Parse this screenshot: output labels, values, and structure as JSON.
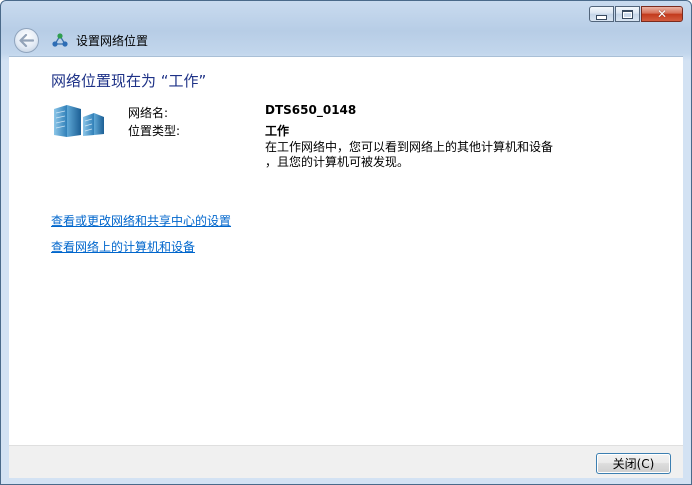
{
  "window": {
    "title": "设置网络位置",
    "close_symbol": "✕"
  },
  "main": {
    "heading": "网络位置现在为 “工作”",
    "network_name_label": "网络名:",
    "network_name_value": "DTS650_0148",
    "location_type_label": "位置类型:",
    "location_type_value": "工作",
    "description_line1": "在工作网络中，您可以看到网络上的其他计算机和设备",
    "description_line2": "，且您的计算机可被发现。",
    "links": [
      "查看或更改网络和共享中心的设置",
      "查看网络上的计算机和设备"
    ]
  },
  "footer": {
    "close_button_label": "关闭(C)"
  },
  "icons": {
    "back": "back-arrow-icon",
    "title": "network-icon",
    "network": "network-building-icon"
  }
}
